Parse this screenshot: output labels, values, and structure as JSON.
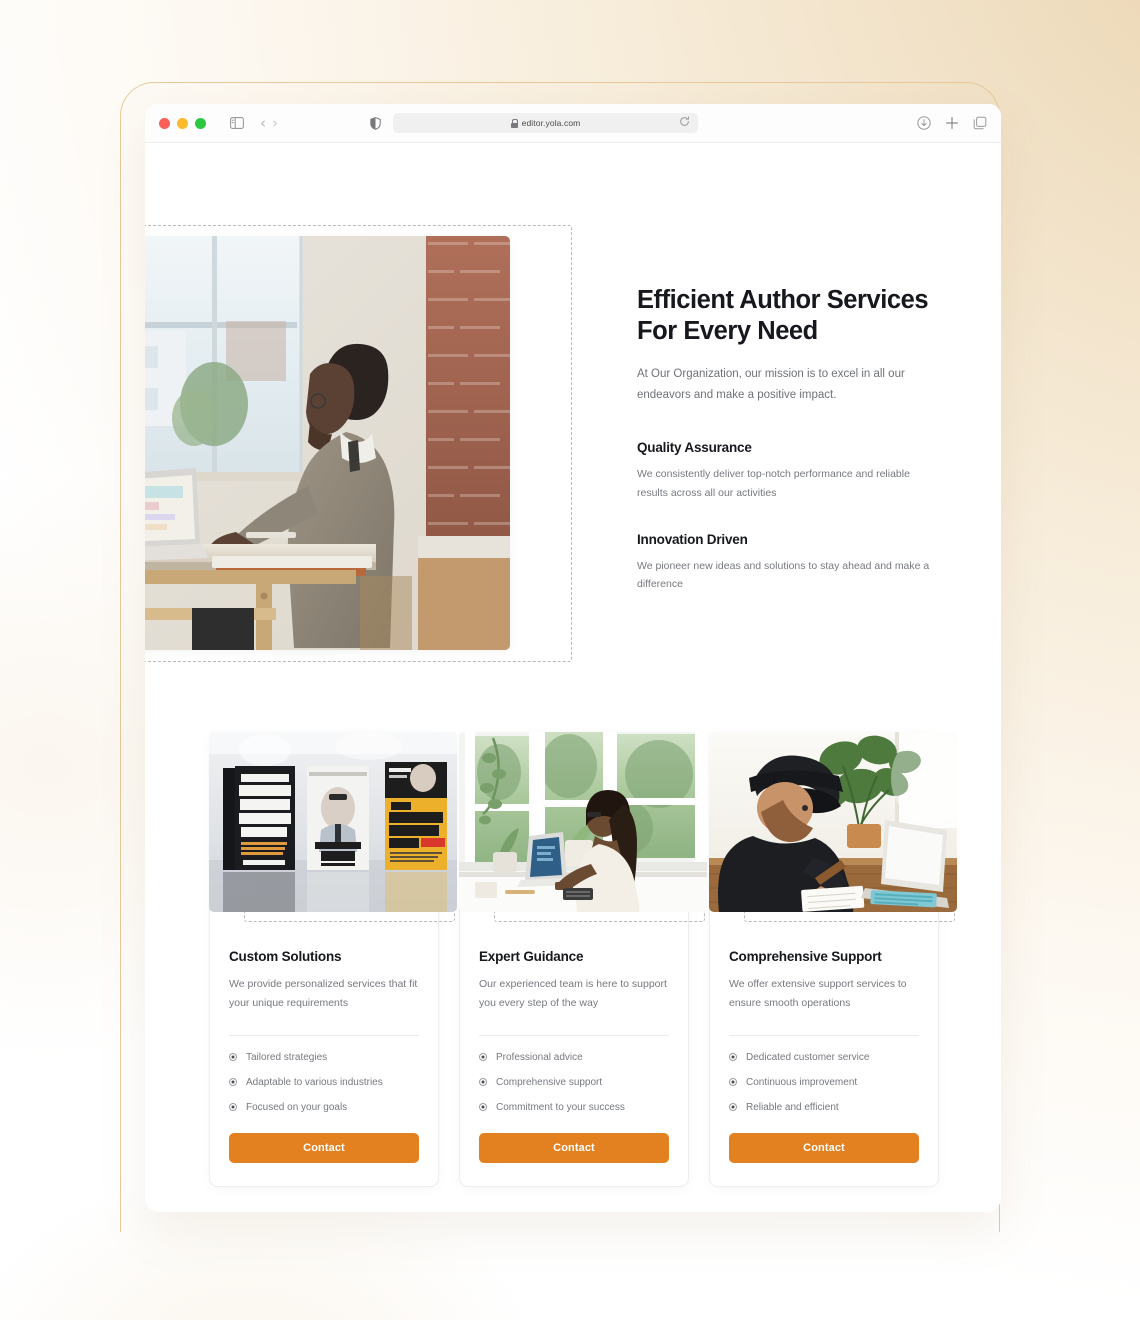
{
  "browser": {
    "url": "editor.yola.com",
    "icons": {
      "sidebar": "sidebar-icon",
      "back": "chevron-left-icon",
      "forward": "chevron-right-icon",
      "shield": "shield-icon",
      "lock": "lock-icon",
      "reload": "reload-icon",
      "download": "download-icon",
      "new_tab": "plus-icon",
      "tab_overview": "tab-overview-icon"
    },
    "traffic_lights": [
      "close-red",
      "minimize-yellow",
      "zoom-green"
    ]
  },
  "hero": {
    "heading": "Efficient Author Services For Every Need",
    "subtitle": "At Our Organization, our mission is to excel in all our endeavors and make a positive impact.",
    "image_alt": "man-working-at-laptop-by-window",
    "features": [
      {
        "title": "Quality Assurance",
        "text": "We consistently deliver top-notch performance and reliable results across all our activities"
      },
      {
        "title": "Innovation Driven",
        "text": "We pioneer new ideas and solutions to stay ahead and make a difference"
      }
    ]
  },
  "cards": [
    {
      "title": "Custom Solutions",
      "text": "We provide personalized services that fit your unique requirements",
      "image_alt": "business-books-on-display",
      "items": [
        "Tailored strategies",
        "Adaptable to various industries",
        "Focused on your goals"
      ],
      "cta": "Contact"
    },
    {
      "title": "Expert Guidance",
      "text": "Our experienced team is here to support you every step of the way",
      "image_alt": "woman-working-at-laptop-by-windows",
      "items": [
        "Professional advice",
        "Comprehensive support",
        "Commitment to your success"
      ],
      "cta": "Contact"
    },
    {
      "title": "Comprehensive Support",
      "text": "We offer extensive support services to ensure smooth operations",
      "image_alt": "man-writing-notes-beside-laptop",
      "items": [
        "Dedicated customer service",
        "Continuous improvement",
        "Reliable and efficient"
      ],
      "cta": "Contact"
    }
  ],
  "colors": {
    "accent": "#e3801f",
    "heading": "#16181d",
    "body_text": "#76797f",
    "frame_border": "#e7c99a",
    "backdrop_warm": "#f0dfc3"
  }
}
